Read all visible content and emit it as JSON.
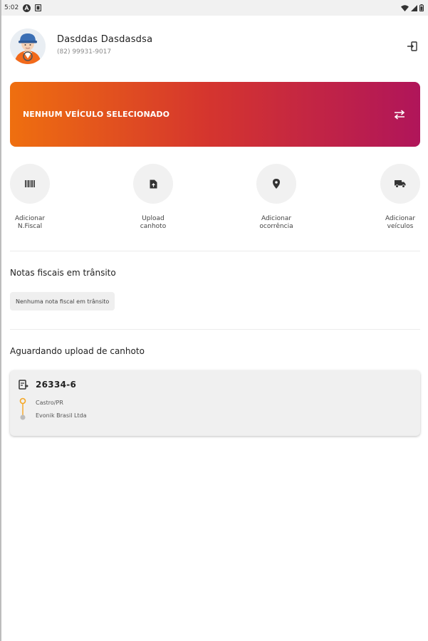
{
  "status_bar": {
    "time": "5:02"
  },
  "user": {
    "name": "Dasddas Dasdasdsa",
    "phone": "(82) 99931-9017"
  },
  "vehicle": {
    "label": "NENHUM VEÍCULO SELECIONADO"
  },
  "actions": [
    {
      "line1": "Adicionar",
      "line2": "N.Fiscal"
    },
    {
      "line1": "Upload",
      "line2": "canhoto"
    },
    {
      "line1": "Adicionar",
      "line2": "ocorrência"
    },
    {
      "line1": "Adicionar",
      "line2": "veículos"
    }
  ],
  "transit": {
    "title": "Notas fiscais em trânsito",
    "empty_text": "Nenhuma nota fiscal em trânsito"
  },
  "awaiting": {
    "title": "Aguardando upload de canhoto",
    "items": [
      {
        "number": "26334-6",
        "origin": "Castro/PR",
        "destination": "Evonik Brasil Ltda"
      }
    ]
  },
  "colors": {
    "gradient_start": "#ef6f0f",
    "gradient_end": "#b0155a",
    "route_accent": "#f5a623"
  }
}
